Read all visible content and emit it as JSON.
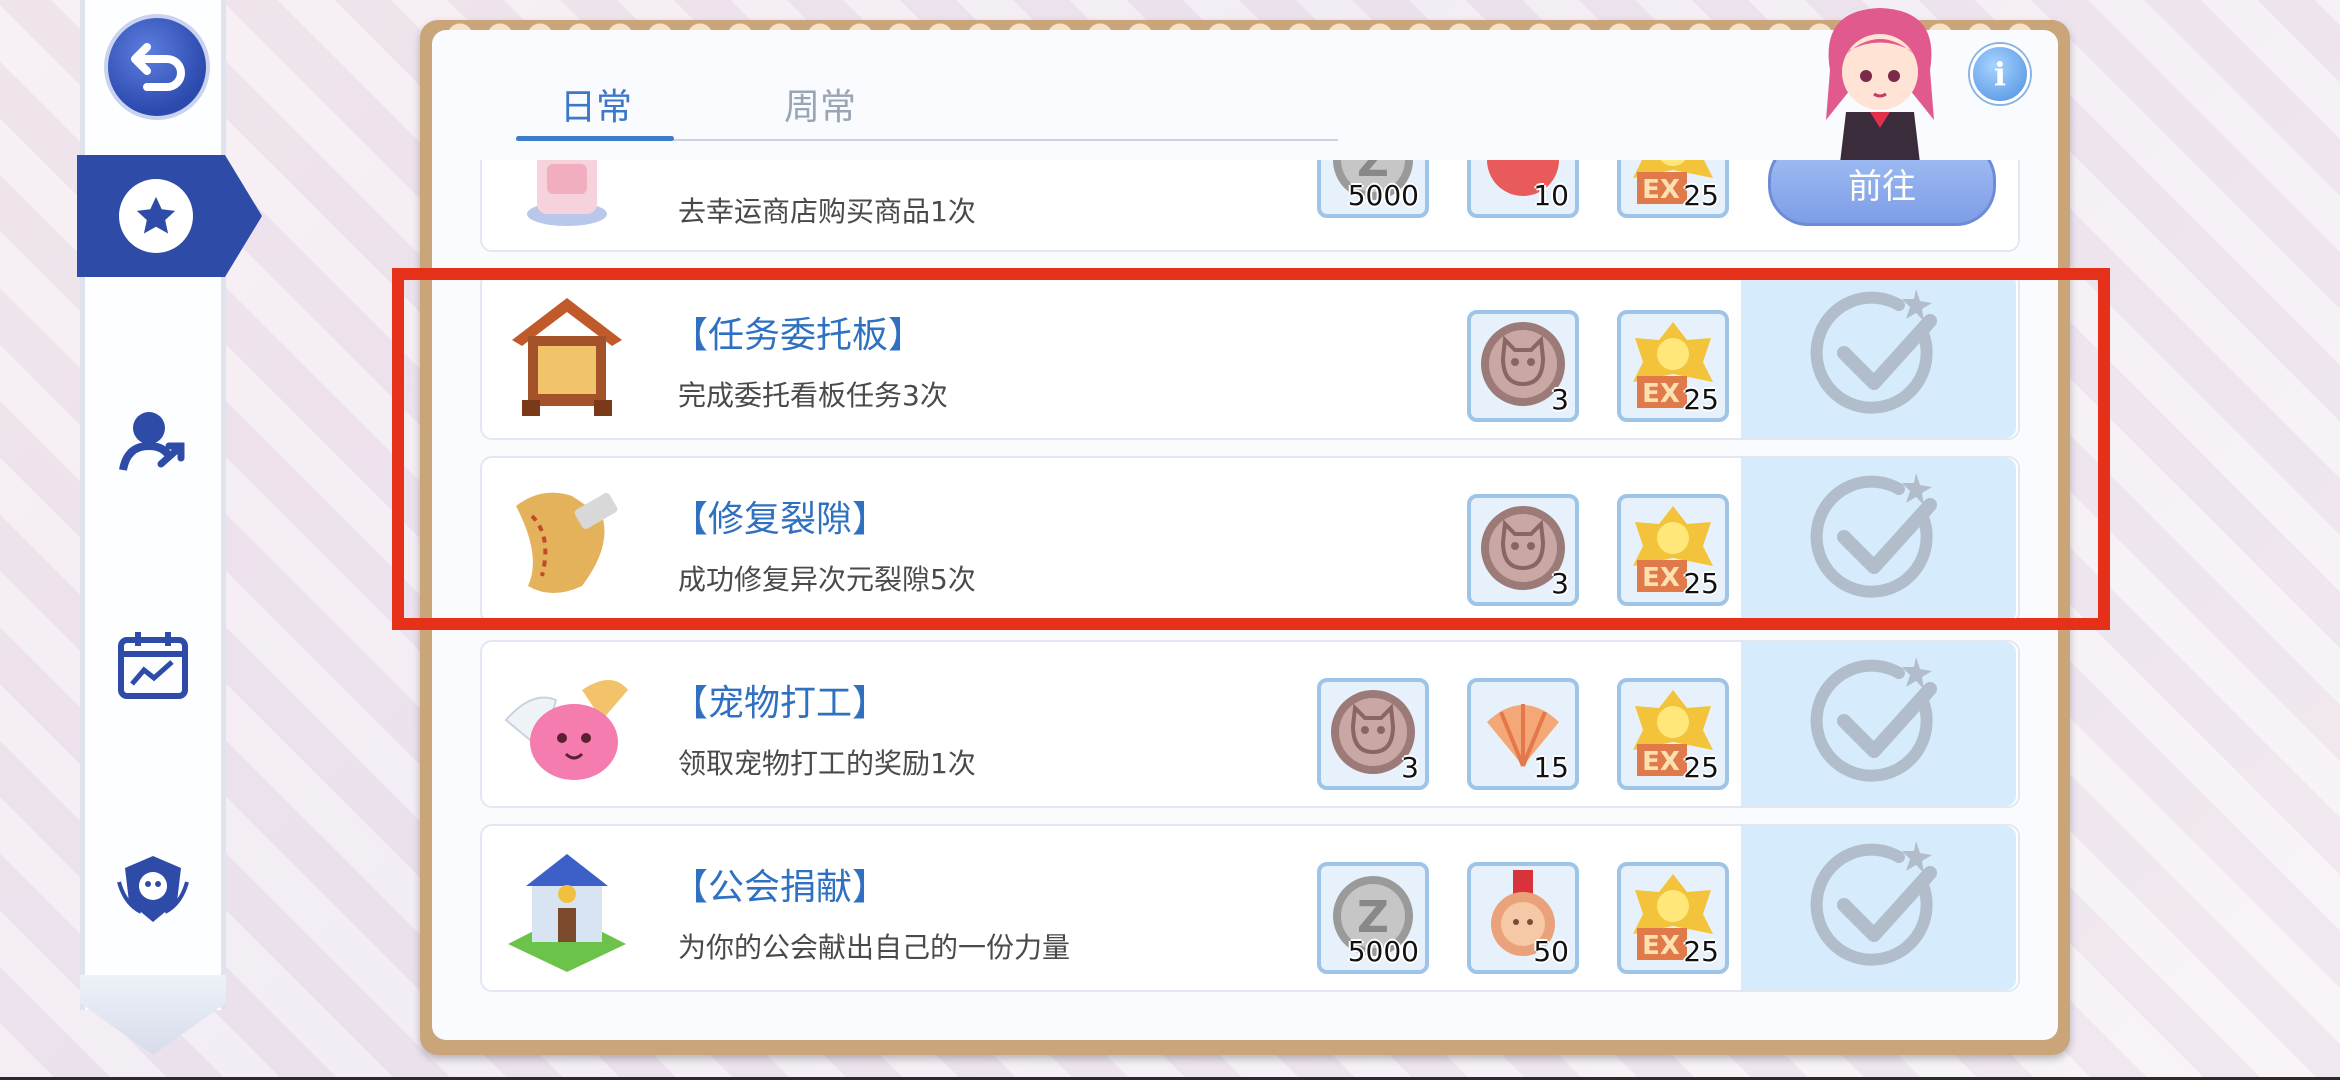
{
  "tabs": [
    {
      "label": "日常"
    },
    {
      "label": "周常"
    }
  ],
  "info_label": "i",
  "quests": [
    {
      "title": "",
      "desc": "去幸运商店购买商品1次",
      "rewards": [
        {
          "icon": "zeny-coin-icon",
          "qty": "5000"
        },
        {
          "icon": "red-item-icon",
          "qty": "10"
        },
        {
          "icon": "ex-badge-icon",
          "qty": "25"
        }
      ],
      "action": "前往"
    },
    {
      "title": "【任务委托板】",
      "desc": "完成委托看板任务3次",
      "rewards": [
        {
          "icon": "cat-coin-icon",
          "qty": "3"
        },
        {
          "icon": "ex-badge-icon",
          "qty": "25"
        }
      ],
      "action": "done"
    },
    {
      "title": "【修复裂隙】",
      "desc": "成功修复异次元裂隙5次",
      "rewards": [
        {
          "icon": "cat-coin-icon",
          "qty": "3"
        },
        {
          "icon": "ex-badge-icon",
          "qty": "25"
        }
      ],
      "action": "done"
    },
    {
      "title": "【宠物打工】",
      "desc": "领取宠物打工的奖励1次",
      "rewards": [
        {
          "icon": "cat-coin-icon",
          "qty": "3"
        },
        {
          "icon": "shell-icon",
          "qty": "15"
        },
        {
          "icon": "ex-badge-icon",
          "qty": "25"
        }
      ],
      "action": "done"
    },
    {
      "title": "【公会捐献】",
      "desc": "为你的公会献出自己的一份力量",
      "rewards": [
        {
          "icon": "zeny-coin-icon",
          "qty": "5000"
        },
        {
          "icon": "medal-icon",
          "qty": "50"
        },
        {
          "icon": "ex-badge-icon",
          "qty": "25"
        }
      ],
      "action": "done"
    }
  ],
  "colors": {
    "accent": "#3c77c8",
    "highlight": "#e5311a",
    "sidebar_active": "#2f4ba8"
  }
}
